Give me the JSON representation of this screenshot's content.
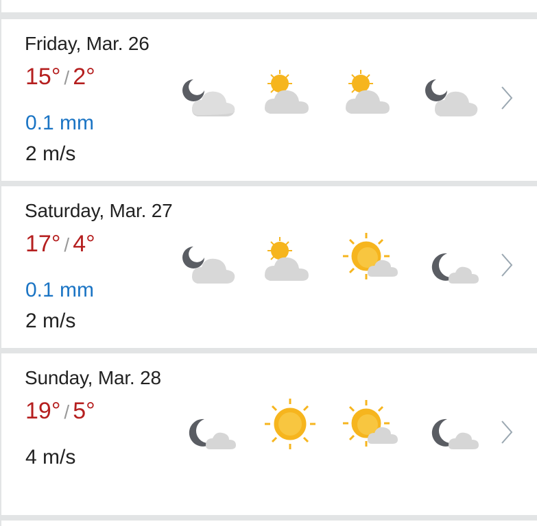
{
  "days": [
    {
      "name": "Friday, Mar. 26",
      "high": "15°",
      "low": "2°",
      "precip": "0.1 mm",
      "wind": "2 m/s",
      "icons": [
        "moon-cloud-icon",
        "sun-cloud-icon",
        "sun-cloud-icon",
        "moon-cloud-icon"
      ]
    },
    {
      "name": "Saturday, Mar. 27",
      "high": "17°",
      "low": "4°",
      "precip": "0.1 mm",
      "wind": "2 m/s",
      "icons": [
        "moon-cloud-icon",
        "sun-cloud-icon",
        "sun-small-cloud-icon",
        "moon-small-cloud-icon"
      ]
    },
    {
      "name": "Sunday, Mar. 28",
      "high": "19°",
      "low": "5°",
      "precip": "",
      "wind": "4 m/s",
      "icons": [
        "moon-small-cloud-icon",
        "sun-icon",
        "sun-small-cloud-icon",
        "moon-small-cloud-icon"
      ]
    }
  ],
  "separator": "/",
  "colors": {
    "temperature": "#b51f1f",
    "precipitation": "#1a74c4",
    "sun": "#f6b51e",
    "cloud": "#cfcfcf",
    "moon": "#5a5d63"
  }
}
